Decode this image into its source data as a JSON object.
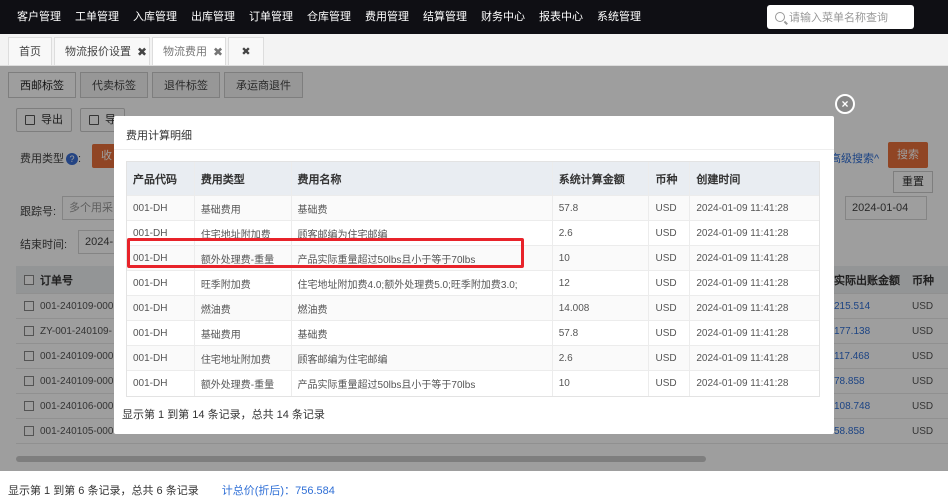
{
  "topnav": {
    "menus": [
      "客户管理",
      "工单管理",
      "入库管理",
      "出库管理",
      "订单管理",
      "仓库管理",
      "费用管理",
      "结算管理",
      "财务中心",
      "报表中心",
      "系统管理"
    ],
    "search_placeholder": "请输入菜单名称查询"
  },
  "page_tabs": [
    {
      "label": "首页"
    },
    {
      "label": "物流报价设置"
    },
    {
      "label": "物流费用"
    }
  ],
  "close_mark": "✖",
  "sub_tabs": [
    "西邮标签",
    "代卖标签",
    "退件标签",
    "承运商退件"
  ],
  "toolbar": {
    "export_label": "导出",
    "second_label": "导"
  },
  "filters": {
    "fee_type_label": "费用类型",
    "fee_type_btn": "收",
    "tracking_label": "跟踪号:",
    "tracking_placeholder": "多个用采",
    "end_time_label": "结束时间:",
    "end_time_value": "2024-",
    "date_value": "2024-01-04",
    "advanced_search": "高级搜索^",
    "search_btn": "搜索",
    "reset_btn": "重置"
  },
  "main_table": {
    "order_header": "订单号",
    "actual_header": "实际出账金额",
    "currency_header": "币种",
    "rows": [
      {
        "order": "001-240109-000",
        "amount": "215.514",
        "currency": "USD"
      },
      {
        "order": "ZY-001-240109-",
        "amount": "177.138",
        "currency": "USD"
      },
      {
        "order": "001-240109-000",
        "amount": "117.468",
        "currency": "USD"
      },
      {
        "order": "001-240109-000",
        "amount": "78.858",
        "currency": "USD"
      },
      {
        "order": "001-240106-000",
        "amount": "108.748",
        "currency": "USD"
      },
      {
        "order": "001-240105-000",
        "amount": "58.858",
        "currency": "USD"
      }
    ]
  },
  "modal": {
    "title": "费用计算明细",
    "close_icon": "×",
    "headers": [
      "产品代码",
      "费用类型",
      "费用名称",
      "系统计算金额",
      "币种",
      "创建时间"
    ],
    "rows": [
      [
        "001-DH",
        "基础费用",
        "基础费",
        "57.8",
        "USD",
        "2024-01-09 11:41:28"
      ],
      [
        "001-DH",
        "住宅地址附加费",
        "顾客邮编为住宅邮编",
        "2.6",
        "USD",
        "2024-01-09 11:41:28"
      ],
      [
        "001-DH",
        "额外处理费-重量",
        "产品实际重量超过50lbs且小于等于70lbs",
        "10",
        "USD",
        "2024-01-09 11:41:28"
      ],
      [
        "001-DH",
        "旺季附加费",
        "住宅地址附加费4.0;额外处理费5.0;旺季附加费3.0;",
        "12",
        "USD",
        "2024-01-09 11:41:28"
      ],
      [
        "001-DH",
        "燃油费",
        "燃油费",
        "14.008",
        "USD",
        "2024-01-09 11:41:28"
      ],
      [
        "001-DH",
        "基础费用",
        "基础费",
        "57.8",
        "USD",
        "2024-01-09 11:41:28"
      ],
      [
        "001-DH",
        "住宅地址附加费",
        "顾客邮编为住宅邮编",
        "2.6",
        "USD",
        "2024-01-09 11:41:28"
      ],
      [
        "001-DH",
        "额外处理费-重量",
        "产品实际重量超过50lbs且小于等于70lbs",
        "10",
        "USD",
        "2024-01-09 11:41:28"
      ]
    ],
    "footer": "显示第 1 到第 14 条记录，总共 14 条记录"
  },
  "footer": {
    "summary": "显示第 1 到第 6 条记录，总共 6 条记录",
    "total": "计总价(折后)：756.584"
  },
  "colors": {
    "highlight": "#e8232a",
    "accent": "#e8703a",
    "link": "#2f6fd6"
  }
}
